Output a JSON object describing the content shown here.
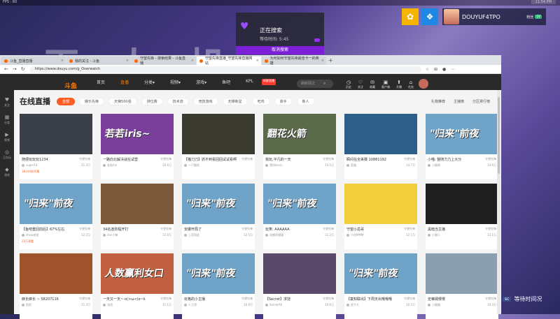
{
  "overlay": {
    "fps": "FPS : 60",
    "clock": "11:54 PM",
    "bg_text": "无    人    机"
  },
  "stream_top": {
    "username": "DOUYUF4TPO",
    "level_label": "粉丝",
    "level_value": "LV",
    "icons": [
      "fish-icon",
      "group-icon"
    ]
  },
  "search_panel": {
    "status": "正在搜索",
    "time": "等待时间: 5:45",
    "cancel": "取消搜索"
  },
  "browser": {
    "tabs": [
      {
        "label": "斗鱼_直播直播",
        "active": false
      },
      {
        "label": "我的关注 - 斗鱼",
        "active": false
      },
      {
        "label": "守望先锋 - 搜索结果 - 斗鱼直播",
        "active": false
      },
      {
        "label": "守望先锋直播_守望先锋直播网站",
        "active": true
      },
      {
        "label": "为何如何守望先锋最佳卡一的英雄",
        "active": false
      }
    ],
    "url": "https://www.douyu.com/g_Overwatch"
  },
  "douyu": {
    "logo": "斗鱼",
    "nav": [
      {
        "label": "首页",
        "active": false
      },
      {
        "label": "直播",
        "active": true
      },
      {
        "label": "分类▾",
        "active": false
      },
      {
        "label": "视频▾",
        "active": false
      },
      {
        "label": "游戏▾",
        "active": false
      },
      {
        "label": "鱼吧",
        "active": false
      },
      {
        "label": "KPL",
        "active": false
      }
    ],
    "nav_badge": "新鲜直播",
    "search_placeholder": "刷新网文",
    "header_icons": [
      {
        "icon": "history-icon",
        "label": "历史"
      },
      {
        "icon": "follow-icon",
        "label": "关注"
      },
      {
        "icon": "favorite-icon",
        "label": "收藏"
      },
      {
        "icon": "client-icon",
        "label": "客户端"
      },
      {
        "icon": "upload-icon",
        "label": "开播"
      },
      {
        "icon": "gift-icon",
        "label": "任务"
      },
      {
        "icon": "user-icon",
        "label": "DOUYUF4TPO"
      }
    ],
    "left_rail": [
      {
        "icon": "heart-icon",
        "label": "关注"
      },
      {
        "icon": "grid-icon",
        "label": "分类"
      },
      {
        "icon": "video-icon",
        "label": "视频"
      },
      {
        "icon": "sports-icon",
        "label": "正在玩"
      },
      {
        "icon": "game-icon",
        "label": "游戏"
      }
    ]
  },
  "live": {
    "heading": "在线直播",
    "chips": [
      "全部",
      "娱乐先锋",
      "天梯500强",
      "排位赛",
      "技术流",
      "竞技游戏",
      "天梯新星",
      "吃鸡",
      "高手",
      "新人"
    ],
    "right_actions": [
      "礼物推荐",
      "主播榜",
      "分区排行榜"
    ]
  },
  "cards": [
    {
      "title": "随便玩玩玩1234",
      "cat": "守望先锋",
      "host": "super14",
      "heat": "21.3万",
      "tag": "18小时前开播",
      "thumb": "",
      "bg": "#3a3f48"
    },
    {
      "title": "一路向北解决战在试营",
      "cat": "守望先锋",
      "host": "若若iris",
      "heat": "26.6万",
      "tag": "",
      "thumb": "若若iris~",
      "bg": "#7a3f9a"
    },
    {
      "title": "【猫刀刀】抓不到看回回试试看啊",
      "cat": "守望先锋",
      "host": "一只猫毛",
      "heat": "",
      "tag": "",
      "thumb": "",
      "bg": "#3b3a2e"
    },
    {
      "title": "我玩,平凡的一天",
      "cat": "守望先锋",
      "host": "我叫kevin",
      "heat": "15.5万",
      "tag": "",
      "thumb": "翻花火箭",
      "bg": "#5b6a4a"
    },
    {
      "title": "瞬间在全来赛 10881192",
      "cat": "守望先锋",
      "host": "蓝猫",
      "heat": "14.7万",
      "tag": "",
      "thumb": "",
      "bg": "#2e5f8a"
    },
    {
      "title": "小喵: 整随力力上大分",
      "cat": "守望先锋",
      "host": "小猫咪",
      "heat": "14.6万",
      "tag": "",
      "thumb": "\"归来\"前夜",
      "bg": "#6fa4c8"
    },
    {
      "title": "【鱼吧重回前后】67%左右",
      "cat": "守望先锋",
      "host": "show老皮",
      "heat": "12.2万",
      "tag": "23万观看",
      "thumb": "\"归来\"前夜",
      "bg": "#6fa4c8"
    },
    {
      "title": "34名连败程开打",
      "cat": "守望先锋",
      "host": "mic小锋",
      "heat": "12.6万",
      "tag": "",
      "thumb": "",
      "bg": "#7a5a3a"
    },
    {
      "title": "安娜开局了",
      "cat": "守望先锋",
      "host": "上官如此",
      "heat": "12.5万",
      "tag": "",
      "thumb": "\"归来\"前夜",
      "bg": "#6fa4c8"
    },
    {
      "title": "玩笑: AAAAAA",
      "cat": "守望先锋",
      "host": "选搬的猫猫",
      "heat": "12.2万",
      "tag": "",
      "thumb": "\"归来\"前夜",
      "bg": "#6fa4c8"
    },
    {
      "title": "守望小岳哥",
      "cat": "守望先锋",
      "host": "小岳MMM",
      "heat": "12.1万",
      "tag": "",
      "thumb": "",
      "bg": "#f2cf3d"
    },
    {
      "title": "黑暗当主播",
      "cat": "守望先锋",
      "host": "小猫人",
      "heat": "12.1万",
      "tag": "",
      "thumb": "",
      "bg": "#1e1e1e"
    },
    {
      "title": "麻长麻长 ~ 58207116",
      "cat": "守望先锋",
      "host": "凯凯",
      "heat": "11.3万",
      "tag": "",
      "thumb": "",
      "bg": "#a0522d"
    },
    {
      "title": "一天又一天~-o(>ω<)o~k",
      "cat": "守望先锋",
      "host": "浅语",
      "heat": "11.1万",
      "tag": "",
      "thumb": "人数赢利女口",
      "bg": "#c06040"
    },
    {
      "title": "玩格的小主播",
      "cat": "守望先锋",
      "host": "人工哥",
      "heat": "10.9万",
      "tag": "",
      "thumb": "\"归来\"前夜",
      "bg": "#6fa4c8"
    },
    {
      "title": "【Secret】求饶",
      "cat": "守望先锋",
      "host": "SecretAK",
      "heat": "10.6万",
      "tag": "",
      "thumb": "",
      "bg": "#5a4a6a"
    },
    {
      "title": "【童知联出】下周天出哦哦哦",
      "cat": "守望先锋",
      "host": "逆子大",
      "heat": "10.5万",
      "tag": "",
      "thumb": "\"归来\"前夜",
      "bg": "#6fa4c8"
    },
    {
      "title": "史蒂姆慢慢",
      "cat": "守望先锋",
      "host": "小猫猫",
      "heat": "10.3万",
      "tag": "",
      "thumb": "",
      "bg": "#8aa0b0"
    }
  ],
  "right_note": {
    "tag": "sc",
    "text": "等待时间况"
  }
}
